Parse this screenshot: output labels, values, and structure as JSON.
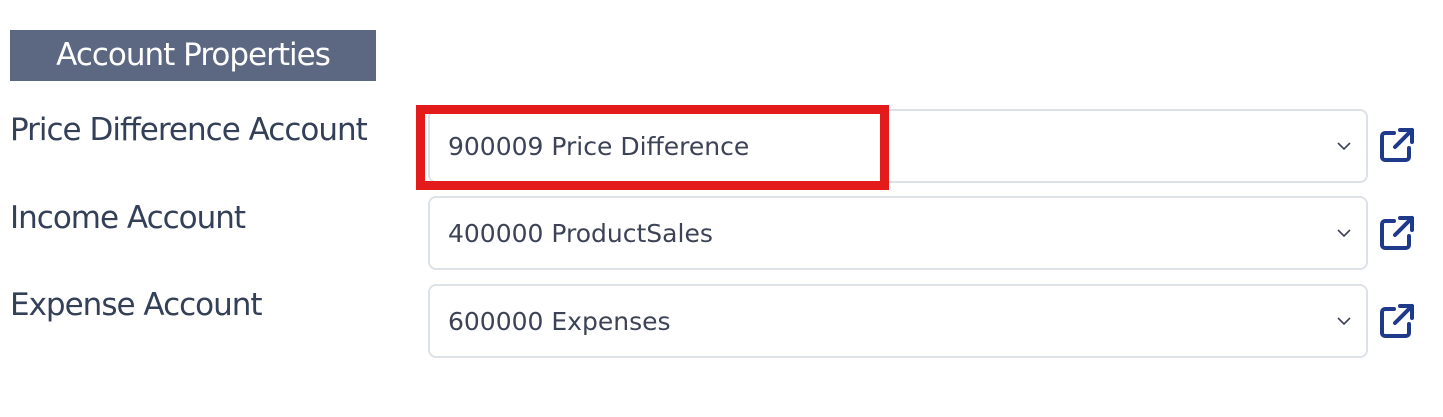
{
  "section": {
    "title": "Account Properties"
  },
  "fields": [
    {
      "label": "Price Difference Account",
      "value": "900009 Price Difference",
      "icon": "external-link-icon"
    },
    {
      "label": "Income Account",
      "value": "400000 ProductSales",
      "icon": "external-link-icon"
    },
    {
      "label": "Expense Account",
      "value": "600000 Expenses",
      "icon": "external-link-icon"
    }
  ],
  "colors": {
    "header_bg": "#5c6782",
    "label_text": "#344058",
    "highlight": "#e31b1b",
    "icon": "#1f3a8a"
  }
}
